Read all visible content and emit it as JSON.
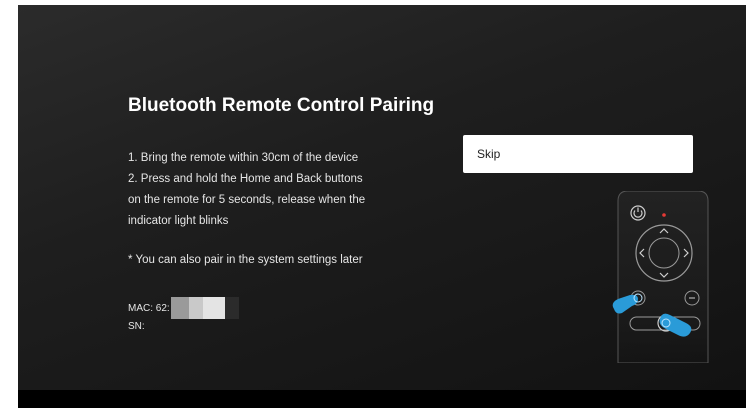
{
  "pairing": {
    "title": "Bluetooth Remote Control Pairing",
    "steps": [
      "1. Bring the remote within 30cm of the device",
      "2. Press and hold the Home and Back buttons",
      "on the remote for 5 seconds, release when the",
      "indicator light blinks"
    ],
    "note": "* You can also pair in the system settings later",
    "mac_label": "MAC: 62:",
    "sn_label": "SN:",
    "skip_label": "Skip"
  },
  "remote_icons": [
    "power-icon",
    "indicator-light-icon",
    "dpad-icon",
    "home-button-icon",
    "back-button-icon",
    "volume-rocker-icon",
    "hand-pointer-icon"
  ],
  "colors": {
    "background": "#1a1a1a",
    "text": "#ffffff",
    "button_bg": "#ffffff",
    "hand_accent": "#2a9bd8",
    "indicator": "#e53935"
  }
}
